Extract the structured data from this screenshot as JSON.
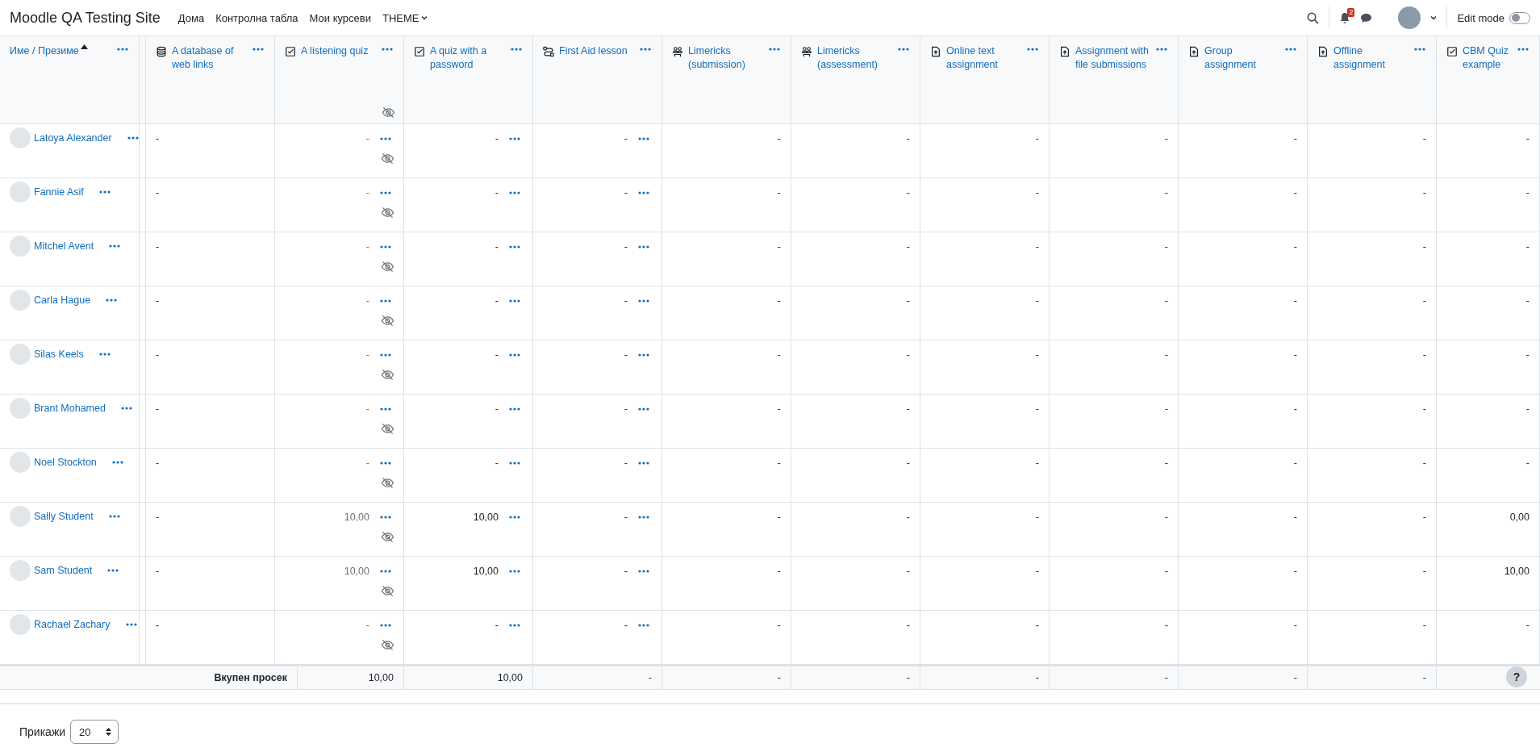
{
  "navbar": {
    "site_name": "Moodle QA Testing Site",
    "links": [
      {
        "label": "Дома",
        "dropdown": false
      },
      {
        "label": "Контролна табла",
        "dropdown": false
      },
      {
        "label": "Мои курсеви",
        "dropdown": false
      },
      {
        "label": "THEME",
        "dropdown": true
      }
    ],
    "notification_count": "2",
    "edit_mode": {
      "label": "Edit mode",
      "on": false
    }
  },
  "table": {
    "name_column": {
      "label": "Име / Презиме",
      "sorted_ascending": true
    },
    "columns": [
      {
        "title": "A database of web links",
        "kind": "database",
        "hidden": false,
        "menu": false
      },
      {
        "title": "A listening quiz",
        "kind": "quiz",
        "hidden": true,
        "menu": true
      },
      {
        "title": "A quiz with a password",
        "kind": "quiz",
        "hidden": false,
        "menu": true
      },
      {
        "title": "First Aid lesson",
        "kind": "lesson",
        "hidden": false,
        "menu": true
      },
      {
        "title": "Limericks (submission)",
        "kind": "workshop",
        "hidden": false,
        "menu": false
      },
      {
        "title": "Limericks (assessment)",
        "kind": "workshop",
        "hidden": false,
        "menu": false
      },
      {
        "title": "Online text assignment",
        "kind": "assign",
        "hidden": false,
        "menu": false
      },
      {
        "title": "Assignment with file submissions",
        "kind": "assign",
        "hidden": false,
        "menu": false
      },
      {
        "title": "Group assignment",
        "kind": "assign",
        "hidden": false,
        "menu": false
      },
      {
        "title": "Offline assignment",
        "kind": "assign",
        "hidden": false,
        "menu": false
      },
      {
        "title": "CBM Quiz example",
        "kind": "quiz",
        "hidden": false,
        "menu": false
      }
    ],
    "rows": [
      {
        "name": "Latoya Alexander",
        "cells": [
          "-",
          "-",
          "-",
          "-",
          "-",
          "-",
          "-",
          "-",
          "-",
          "-",
          "-"
        ]
      },
      {
        "name": "Fannie Asif",
        "cells": [
          "-",
          "-",
          "-",
          "-",
          "-",
          "-",
          "-",
          "-",
          "-",
          "-",
          "-"
        ]
      },
      {
        "name": "Mitchel Avent",
        "cells": [
          "-",
          "-",
          "-",
          "-",
          "-",
          "-",
          "-",
          "-",
          "-",
          "-",
          "-"
        ]
      },
      {
        "name": "Carla Hague",
        "cells": [
          "-",
          "-",
          "-",
          "-",
          "-",
          "-",
          "-",
          "-",
          "-",
          "-",
          "-"
        ]
      },
      {
        "name": "Silas Keels",
        "cells": [
          "-",
          "-",
          "-",
          "-",
          "-",
          "-",
          "-",
          "-",
          "-",
          "-",
          "-"
        ]
      },
      {
        "name": "Brant Mohamed",
        "cells": [
          "-",
          "-",
          "-",
          "-",
          "-",
          "-",
          "-",
          "-",
          "-",
          "-",
          "-"
        ]
      },
      {
        "name": "Noel Stockton",
        "cells": [
          "-",
          "-",
          "-",
          "-",
          "-",
          "-",
          "-",
          "-",
          "-",
          "-",
          "-"
        ]
      },
      {
        "name": "Sally Student",
        "cells": [
          "-",
          "10,00",
          "10,00",
          "-",
          "-",
          "-",
          "-",
          "-",
          "-",
          "-",
          "0,00"
        ]
      },
      {
        "name": "Sam Student",
        "cells": [
          "-",
          "10,00",
          "10,00",
          "-",
          "-",
          "-",
          "-",
          "-",
          "-",
          "-",
          "10,00"
        ]
      },
      {
        "name": "Rachael Zachary",
        "cells": [
          "-",
          "-",
          "-",
          "-",
          "-",
          "-",
          "-",
          "-",
          "-",
          "-",
          "-"
        ]
      }
    ],
    "average": {
      "label": "Вкупен просек",
      "values": [
        "10,00",
        "10,00",
        "-",
        "-",
        "-",
        "-",
        "-",
        "-",
        "-"
      ]
    }
  },
  "footer": {
    "show_label": "Прикажи",
    "per_page": "20"
  },
  "help_button": "?"
}
